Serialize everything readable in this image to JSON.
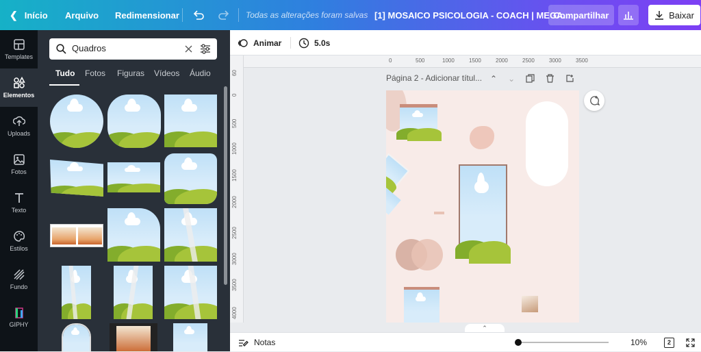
{
  "topbar": {
    "home": "Início",
    "file": "Arquivo",
    "resize": "Redimensionar",
    "saved": "Todas as alterações foram salvas",
    "doc_title": "[1] MOSAICO PSICOLOGIA - COACH | MEGA...",
    "share": "Compartilhar",
    "download": "Baixar"
  },
  "sidebar": {
    "items": [
      {
        "label": "Templates",
        "icon": "templates-icon"
      },
      {
        "label": "Elementos",
        "icon": "elements-icon"
      },
      {
        "label": "Uploads",
        "icon": "upload-icon"
      },
      {
        "label": "Fotos",
        "icon": "photo-icon"
      },
      {
        "label": "Texto",
        "icon": "text-icon"
      },
      {
        "label": "Estilos",
        "icon": "palette-icon"
      },
      {
        "label": "Fundo",
        "icon": "background-icon"
      },
      {
        "label": "GIPHY",
        "icon": "giphy-icon"
      }
    ]
  },
  "panel": {
    "search": {
      "value": "Quadros"
    },
    "tabs": [
      "Tudo",
      "Fotos",
      "Figuras",
      "Vídeos",
      "Áudio"
    ]
  },
  "toolbar": {
    "animate": "Animar",
    "duration": "5.0s"
  },
  "canvas": {
    "page_title": "Página 2 - Adicionar títul...",
    "ruler_top": [
      "0",
      "500",
      "1000",
      "1500",
      "2000",
      "2500",
      "3000",
      "3500"
    ],
    "ruler_left": [
      "60",
      "0",
      "500",
      "1000",
      "1500",
      "2000",
      "2500",
      "3000",
      "3500",
      "4000"
    ]
  },
  "bottombar": {
    "notes": "Notas",
    "zoom": "10%",
    "page_count": "2"
  },
  "colors": {
    "accent": "#7d3ff4",
    "teal": "#16b1c7",
    "page_bg": "#f8ebe8",
    "panel_bg": "#293039"
  }
}
